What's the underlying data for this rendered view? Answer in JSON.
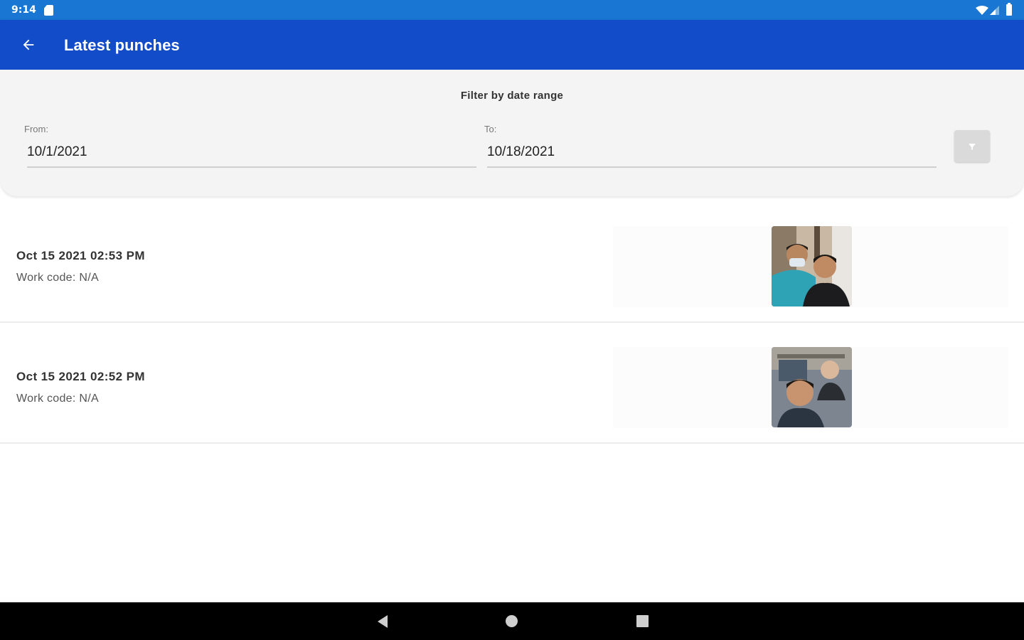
{
  "status_bar": {
    "time": "9:14",
    "icons": [
      "sd-card-icon",
      "wifi-icon",
      "signal-icon",
      "battery-icon"
    ]
  },
  "app_bar": {
    "title": "Latest punches",
    "back_icon": "arrow-back-icon",
    "color": "#124cc8"
  },
  "filter": {
    "title": "Filter by date range",
    "from_label": "From:",
    "from_value": "10/1/2021",
    "to_label": "To:",
    "to_value": "10/18/2021",
    "button_icon": "filter-icon"
  },
  "punches": [
    {
      "datetime": "Oct 15 2021 02:53 PM",
      "work_code": "Work code: N/A",
      "photo": "selfie-photo"
    },
    {
      "datetime": "Oct 15 2021 02:52 PM",
      "work_code": "Work code: N/A",
      "photo": "selfie-photo"
    }
  ],
  "nav_bar": {
    "icons": [
      "nav-back-icon",
      "nav-home-icon",
      "nav-recents-icon"
    ]
  },
  "colors": {
    "status_bar": "#1976d2",
    "app_bar": "#124cc8",
    "filter_card": "#f4f4f4"
  }
}
